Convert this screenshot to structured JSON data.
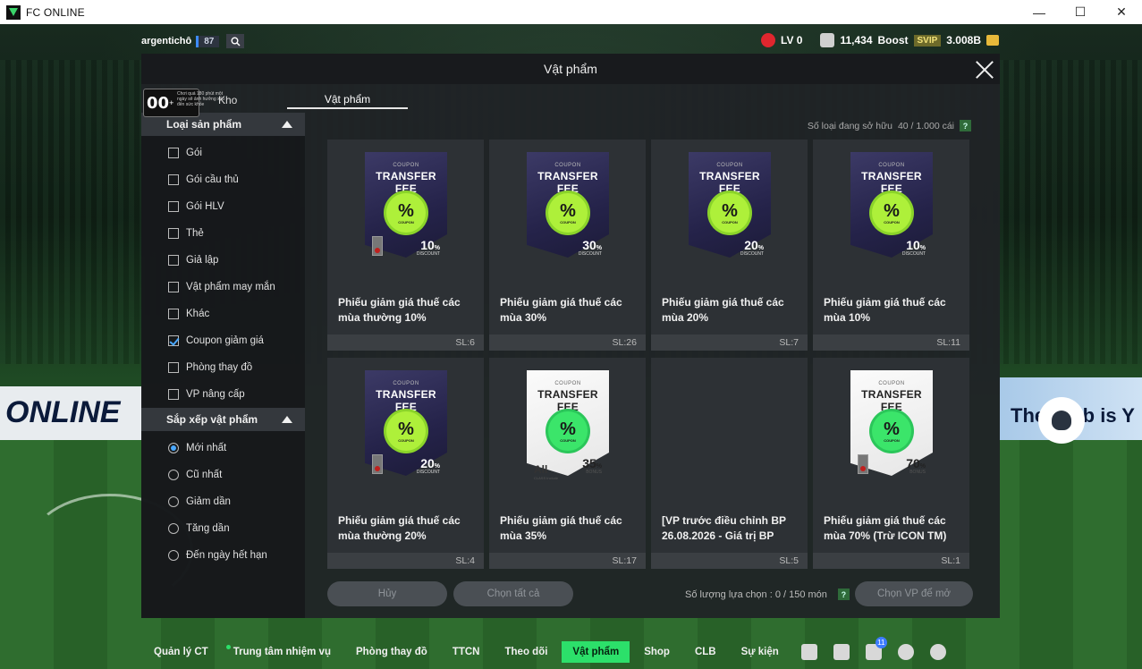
{
  "window": {
    "title": "FC ONLINE",
    "minimize_glyph": "—",
    "maximize_glyph": "☐",
    "close_glyph": "✕"
  },
  "background": {
    "board_left": "ONLINE",
    "board_right": "The Club is Y"
  },
  "hud": {
    "username": "argentichô",
    "level": "87",
    "lv_text": "LV 0",
    "points": "11,434",
    "boost": "Boost",
    "svip": "SVIP",
    "currency": "3.008B"
  },
  "panel": {
    "title": "Vật phẩm",
    "tab_storage": "Kho",
    "tab_items": "Vật phẩm",
    "age_rating": {
      "number": "00",
      "plus": "+",
      "text": "Chơi quá 180 phút một ngày sẽ ảnh hưởng xấu đến sức khỏe"
    },
    "owned_label": "Số loại đang sở hữu",
    "owned_value": "40 / 1.000 cái",
    "help_glyph": "?"
  },
  "filters": {
    "product_type": {
      "title": "Loại sản phẩm",
      "options": [
        {
          "label": "Gói",
          "checked": false
        },
        {
          "label": "Gói cầu thủ",
          "checked": false
        },
        {
          "label": "Gói HLV",
          "checked": false
        },
        {
          "label": "Thẻ",
          "checked": false
        },
        {
          "label": "Giả lập",
          "checked": false
        },
        {
          "label": "Vật phẩm may mắn",
          "checked": false
        },
        {
          "label": "Khác",
          "checked": false
        },
        {
          "label": "Coupon giảm giá",
          "checked": true
        },
        {
          "label": "Phòng thay đồ",
          "checked": false
        },
        {
          "label": "VP nâng cấp",
          "checked": false
        }
      ]
    },
    "sort": {
      "title": "Sắp xếp vật phẩm",
      "options": [
        {
          "label": "Mới nhất",
          "selected": true
        },
        {
          "label": "Cũ nhất",
          "selected": false
        },
        {
          "label": "Giảm dần",
          "selected": false
        },
        {
          "label": "Tăng dần",
          "selected": false
        },
        {
          "label": "Đến ngày hết hạn",
          "selected": false
        }
      ]
    }
  },
  "coupon_text": {
    "small": "COUPON",
    "big": "TRANSFER FEE",
    "badge_pct": "%",
    "badge_word": "COUPON",
    "discount": "DISCOUNT",
    "bonus": "BONUS",
    "pct_sign": "%",
    "all": "All",
    "all_sub": "CLASS Include"
  },
  "items": [
    {
      "name": "Phiếu giảm giá thuế các mùa thường 10%",
      "qty": "SL:6",
      "style": "dark",
      "value": "10",
      "kind": "discount",
      "lock": true
    },
    {
      "name": "Phiếu giảm giá thuế các mùa 30%",
      "qty": "SL:26",
      "style": "dark",
      "value": "30",
      "kind": "discount",
      "lock": false
    },
    {
      "name": "Phiếu giảm giá thuế các mùa 20%",
      "qty": "SL:7",
      "style": "dark",
      "value": "20",
      "kind": "discount",
      "lock": false
    },
    {
      "name": "Phiếu giảm giá thuế các mùa 10%",
      "qty": "SL:11",
      "style": "dark",
      "value": "10",
      "kind": "discount",
      "lock": false
    },
    {
      "name": "Phiếu giảm giá thuế các mùa thường 20%",
      "qty": "SL:4",
      "style": "dark",
      "value": "20",
      "kind": "discount",
      "lock": true
    },
    {
      "name": "Phiếu giảm giá thuế các mùa 35%",
      "qty": "SL:17",
      "style": "light",
      "value": "35",
      "kind": "bonus",
      "lock": false,
      "all": true
    },
    {
      "name": "[VP trước điều chỉnh BP 26.08.2026 - Giá trị BP",
      "qty": "SL:5",
      "style": "none",
      "value": "",
      "kind": "",
      "lock": false
    },
    {
      "name": "Phiếu giảm giá thuế các mùa 70% (Trừ ICON TM)",
      "qty": "SL:1",
      "style": "light",
      "value": "70",
      "kind": "bonus",
      "lock": true
    }
  ],
  "actions": {
    "cancel": "Hủy",
    "select_all": "Chọn tất cả",
    "selected_label": "Số lượng lựa chọn : 0 / 150 món",
    "open": "Chọn VP để mở"
  },
  "bottom_nav": {
    "items": [
      "Quản lý CT",
      "Trung tâm nhiệm vụ",
      "Phòng thay đồ",
      "TTCN",
      "Theo dõi",
      "Vật phẩm",
      "Shop",
      "CLB",
      "Sự kiện"
    ],
    "active_index": 5,
    "notification_count": "11"
  },
  "colors": {
    "accent_green": "#2ce06a",
    "checkbox_blue": "#4aa8ff",
    "coupon_dark": "#2e2c58",
    "coupon_badge": "#aef03a"
  }
}
